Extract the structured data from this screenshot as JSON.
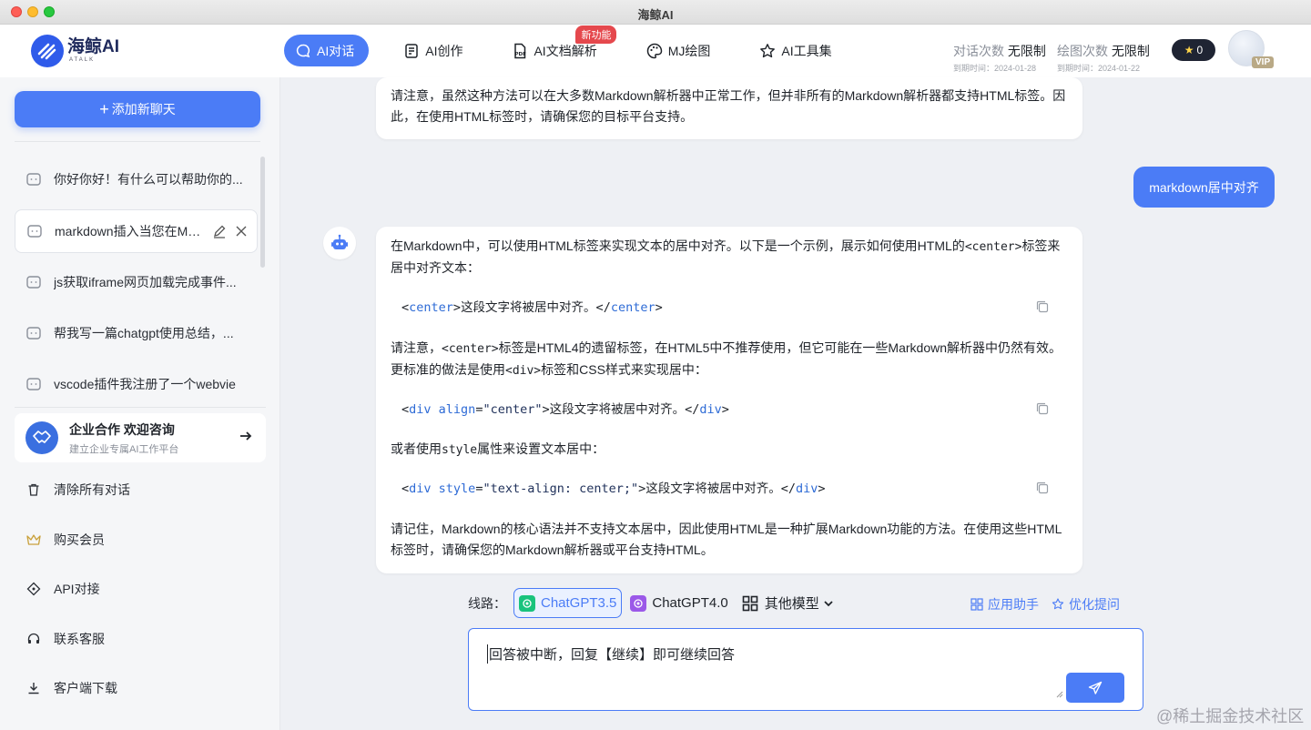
{
  "window": {
    "title": "海鲸AI"
  },
  "logo": {
    "name": "海鲸AI",
    "sub": "ATALK"
  },
  "nav": [
    {
      "label": "AI对话",
      "icon": "chat-bubble-icon",
      "active": true
    },
    {
      "label": "AI创作",
      "icon": "document-icon",
      "active": false
    },
    {
      "label": "AI文档解析",
      "icon": "pdf-icon",
      "active": false,
      "badge": "新功能"
    },
    {
      "label": "MJ绘图",
      "icon": "palette-icon",
      "active": false
    },
    {
      "label": "AI工具集",
      "icon": "star-icon",
      "active": false
    }
  ],
  "quota": {
    "chat_label": "对话次数",
    "chat_value": "无限制",
    "chat_expiry": "到期时间：2024-01-28",
    "draw_label": "绘图次数",
    "draw_value": "无限制",
    "draw_expiry": "到期时间：2024-01-22"
  },
  "user": {
    "stars": "0",
    "vip_label": "VIP"
  },
  "sidebar": {
    "new_chat_label": "添加新聊天",
    "chats": [
      {
        "title": "你好你好！有什么可以帮助你的..."
      },
      {
        "title": "markdown插入当您在Markdo"
      },
      {
        "title": "js获取iframe网页加载完成事件..."
      },
      {
        "title": "帮我写一篇chatgpt使用总结，..."
      },
      {
        "title": "vscode插件我注册了一个webvie"
      }
    ],
    "enterprise": {
      "title": "企业合作 欢迎咨询",
      "subtitle": "建立企业专属AI工作平台"
    },
    "menu": [
      {
        "label": "清除所有对话",
        "icon": "trash-icon"
      },
      {
        "label": "购买会员",
        "icon": "crown-icon"
      },
      {
        "label": "API对接",
        "icon": "api-icon"
      },
      {
        "label": "联系客服",
        "icon": "headset-icon"
      },
      {
        "label": "客户端下载",
        "icon": "download-icon"
      }
    ]
  },
  "messages": {
    "prev_bot": "请注意，虽然这种方法可以在大多数Markdown解析器中正常工作，但并非所有的Markdown解析器都支持HTML标签。因此，在使用HTML标签时，请确保您的目标平台支持。",
    "user": "markdown居中对齐",
    "bot": {
      "p1_a": "在Markdown中，可以使用HTML标签来实现文本的居中对齐。以下是一个示例，展示如何使用HTML的",
      "p1_code": "<center>",
      "p1_b": "标签来居中对齐文本：",
      "code1_open_a": "<",
      "code1_open_tag": "center",
      "code1_open_b": ">",
      "code1_text": "这段文字将被居中对齐。</",
      "code1_close_tag": "center",
      "code1_close_b": ">",
      "p2_a": "请注意，",
      "p2_code": "<center>",
      "p2_b": "标签是HTML4的遗留标签，在HTML5中不推荐使用，但它可能在一些Markdown解析器中仍然有效。更标准的做法是使用",
      "p2_code2": "<div>",
      "p2_c": "标签和CSS样式来实现居中：",
      "code2_lt": "<",
      "code2_tag": "div",
      "code2_attr": "align",
      "code2_val": "\"center\"",
      "code2_text": ">这段文字将被居中对齐。</",
      "code2_close": "div",
      "code2_gt": ">",
      "p3_a": "或者使用",
      "p3_code": "style",
      "p3_b": "属性来设置文本居中：",
      "code3_lt": "<",
      "code3_tag": "div",
      "code3_attr": "style",
      "code3_val": "\"text-align: center;\"",
      "code3_text": ">这段文字将被居中对齐。</",
      "code3_close": "div",
      "code3_gt": ">",
      "p4": "请记住，Markdown的核心语法并不支持文本居中，因此使用HTML是一种扩展Markdown功能的方法。在使用这些HTML标签时，请确保您的Markdown解析器或平台支持HTML。"
    }
  },
  "model_bar": {
    "label": "线路：",
    "models": [
      "ChatGPT3.5",
      "ChatGPT4.0"
    ],
    "other": "其他模型",
    "helper1": "应用助手",
    "helper2": "优化提问"
  },
  "input": {
    "value": "回答被中断，回复【继续】即可继续回答"
  },
  "watermark": "@稀土掘金技术社区",
  "colors": {
    "accent": "#4b7cf6",
    "badge": "#e5484d",
    "gpt35": "#19c37d",
    "gpt4": "#9b59e8"
  }
}
